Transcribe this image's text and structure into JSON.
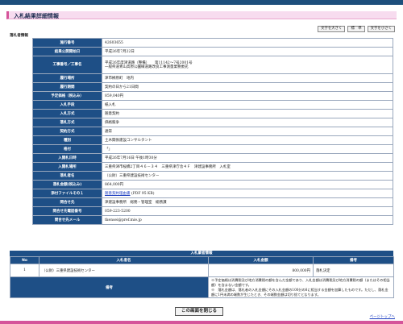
{
  "page": {
    "title": "入札結果詳細情報"
  },
  "font_size_buttons": {
    "large": "文字を大きく",
    "standard": "標　準",
    "small": "文字を小さく"
  },
  "section_label": "落札者情報",
  "details": [
    {
      "label": "施行番号",
      "value": "42603655"
    },
    {
      "label": "結果公開開始日",
      "value": "平成26年7月22日"
    },
    {
      "label": "工事番号／工事名",
      "value_line1": "平成26年度津道路（整備）　　第11142～7号2001号",
      "value_line2": "一般県道青山高原公園線道路改良工事測量業務委託"
    },
    {
      "label": "履行場所",
      "value": "津市榊原町　地内"
    },
    {
      "label": "履行期間",
      "value": "契約の日から21日間"
    },
    {
      "label": "予定価格（税込み）",
      "value": "859,040円"
    },
    {
      "label": "入札手段",
      "value": "紙入札"
    },
    {
      "label": "入札方式",
      "value": "随意契約"
    },
    {
      "label": "落札方式",
      "value": "価格競争"
    },
    {
      "label": "契約方式",
      "value": "通常"
    },
    {
      "label": "種別",
      "value": "土木関係建設コンサルタント"
    },
    {
      "label": "格付",
      "value": "「」"
    },
    {
      "label": "入開札日時",
      "value": "平成26年7月16日 午後1時30分"
    },
    {
      "label": "入開札場所",
      "value": "三重県津市桜橋2丁目４６－３４　三重県津庁舎４Ｆ　津建設事務所　入札室"
    },
    {
      "label": "落札者名",
      "value": "（公財）三重県建設技術センター"
    },
    {
      "label": "落札金額(税込み)",
      "value": "864,000円"
    },
    {
      "label": "添付ファイルその１",
      "link": "随意契約理由書",
      "suffix": "(PDF 95 KB)"
    },
    {
      "label": "問合せ先",
      "value": "津建設事務所　総務・管理室　総務課"
    },
    {
      "label": "問合せ先電話番号",
      "value": "059-223-5200"
    },
    {
      "label": "問合せ先メール",
      "value": "tkensei@pref.mie.jp"
    }
  ],
  "results": {
    "title": "入札業者情報",
    "headers": {
      "no": "No",
      "bidder": "入札者名",
      "amount": "入札金額",
      "note": "備考"
    },
    "rows": [
      {
        "no": "1",
        "bidder": "（公財）三重県建設技術センター",
        "amount": "800,000円",
        "note": "落札決定"
      }
    ],
    "remarks_label": "備考",
    "remarks_line1": "※予定価格は消費税及び地方消費税の額を含んだ金額であり、入札金額は消費税及び地方消費税の額（またはその相当額）を含まない金額です。",
    "remarks_line2": "※　落札金額は、落札者の入札金額にその入札金額の100分の8に相当する金額を加算したものです。ただし、落札金額に1円未満の端数が生じたとき、その端数金額は切り捨てとなります。"
  },
  "close_button": "この画面を閉じる",
  "page_top_link": "ページトップへ",
  "colors": {
    "header_navy": "#1e4f86",
    "accent_pink": "#d5549a",
    "title_bg": "#f7dcef"
  }
}
